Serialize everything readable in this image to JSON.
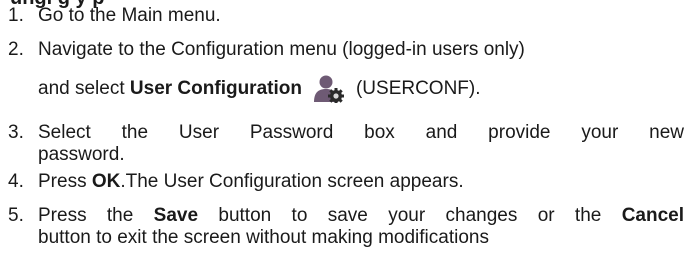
{
  "heading_fragment": "ungi g y p",
  "steps": [
    {
      "num": "1.",
      "text": "Go to the Main menu."
    },
    {
      "num": "2.",
      "line1": "Navigate to the Configuration menu (logged-in users only)",
      "line2_prefix": "and select ",
      "line2_bold": "User Configuration",
      "line2_suffix": "(USERCONF).",
      "icon": "user-config-icon"
    },
    {
      "num": "3.",
      "line1": "Select the User Password box and provide your new",
      "line2": "password."
    },
    {
      "num": "4.",
      "prefix": "Press ",
      "bold": "OK",
      "suffix": ".The User Configuration screen appears."
    },
    {
      "num": "5.",
      "line1_prefix": "Press the ",
      "line1_bold1": "Save",
      "line1_mid": " button to save your changes or the ",
      "line1_bold2": "Cancel",
      "line2": "button to exit the screen without making modifications"
    }
  ],
  "colors": {
    "text": "#1a1a1a",
    "icon_person": "#6e5a74",
    "icon_gear": "#2a2a2a",
    "icon_gear_fill": "#d8d8d8"
  }
}
